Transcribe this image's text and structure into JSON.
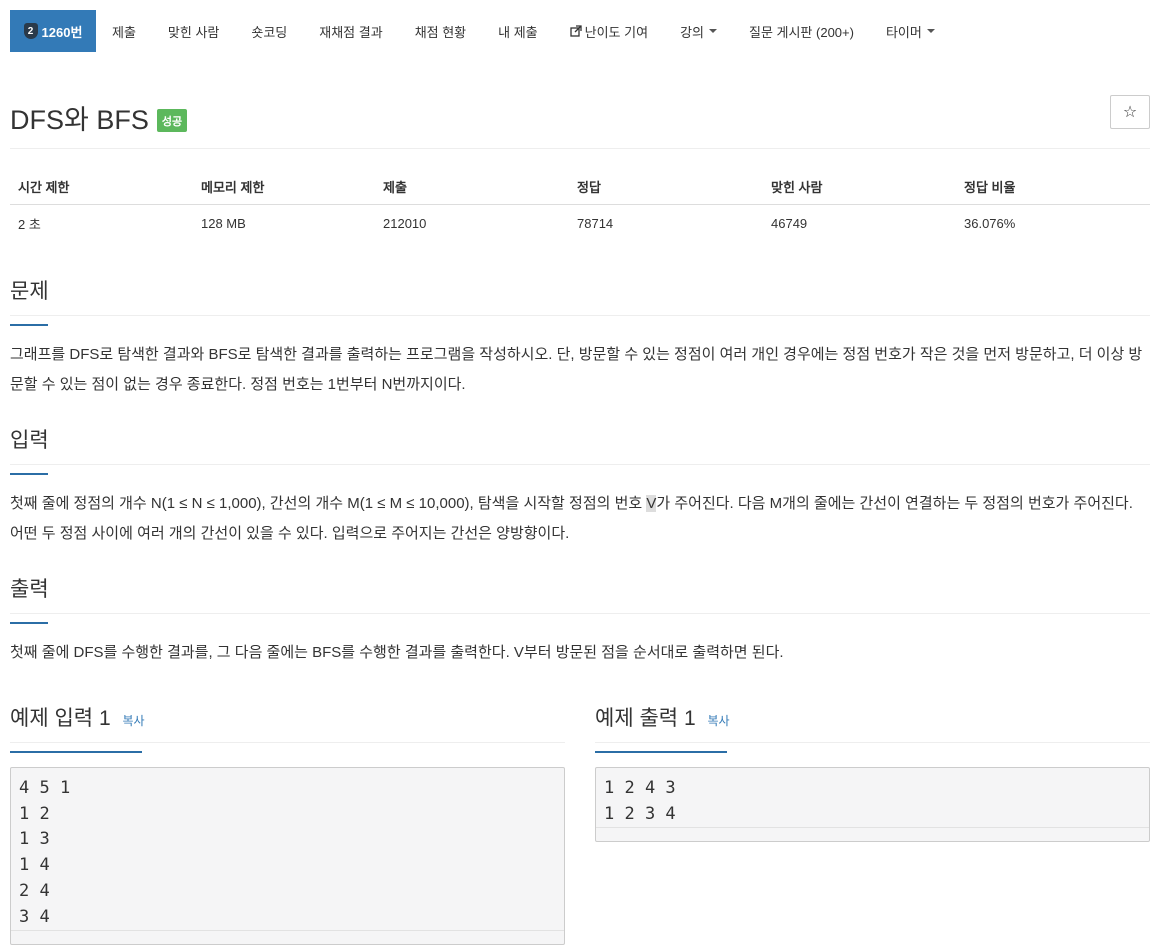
{
  "nav": {
    "active": {
      "tier": "2",
      "label": "1260번"
    },
    "items": [
      {
        "label": "제출"
      },
      {
        "label": "맞힌 사람"
      },
      {
        "label": "숏코딩"
      },
      {
        "label": "재채점 결과"
      },
      {
        "label": "채점 현황"
      },
      {
        "label": "내 제출"
      },
      {
        "label": "난이도 기여",
        "icon": "external-link-icon"
      },
      {
        "label": "강의",
        "dropdown": true
      },
      {
        "label": "질문 게시판 (200+)"
      },
      {
        "label": "타이머",
        "dropdown": true
      }
    ]
  },
  "problem": {
    "title": "DFS와 BFS",
    "status": "성공",
    "star": "☆"
  },
  "info": {
    "headers": [
      "시간 제한",
      "메모리 제한",
      "제출",
      "정답",
      "맞힌 사람",
      "정답 비율"
    ],
    "values": [
      "2 초",
      "128 MB",
      "212010",
      "78714",
      "46749",
      "36.076%"
    ]
  },
  "sections": {
    "problem": {
      "title": "문제",
      "body": "그래프를 DFS로 탐색한 결과와 BFS로 탐색한 결과를 출력하는 프로그램을 작성하시오. 단, 방문할 수 있는 정점이 여러 개인 경우에는 정점 번호가 작은 것을 먼저 방문하고, 더 이상 방문할 수 있는 점이 없는 경우 종료한다. 정점 번호는 1번부터 N번까지이다."
    },
    "input": {
      "title": "입력",
      "body_before": "첫째 줄에 정점의 개수 N(1 ≤ N ≤ 1,000), 간선의 개수 M(1 ≤ M ≤ 10,000), 탐색을 시작할 정점의 번호 ",
      "body_highlight": "V",
      "body_after": "가 주어진다. 다음 M개의 줄에는 간선이 연결하는 두 정점의 번호가 주어진다. 어떤 두 정점 사이에 여러 개의 간선이 있을 수 있다. 입력으로 주어지는 간선은 양방향이다."
    },
    "output": {
      "title": "출력",
      "body": "첫째 줄에 DFS를 수행한 결과를, 그 다음 줄에는 BFS를 수행한 결과를 출력한다. V부터 방문된 점을 순서대로 출력하면 된다."
    }
  },
  "samples": {
    "input": {
      "title": "예제 입력 1",
      "copy": "복사",
      "data": "4 5 1\n1 2\n1 3\n1 4\n2 4\n3 4"
    },
    "output": {
      "title": "예제 출력 1",
      "copy": "복사",
      "data": "1 2 4 3\n1 2 3 4"
    }
  }
}
